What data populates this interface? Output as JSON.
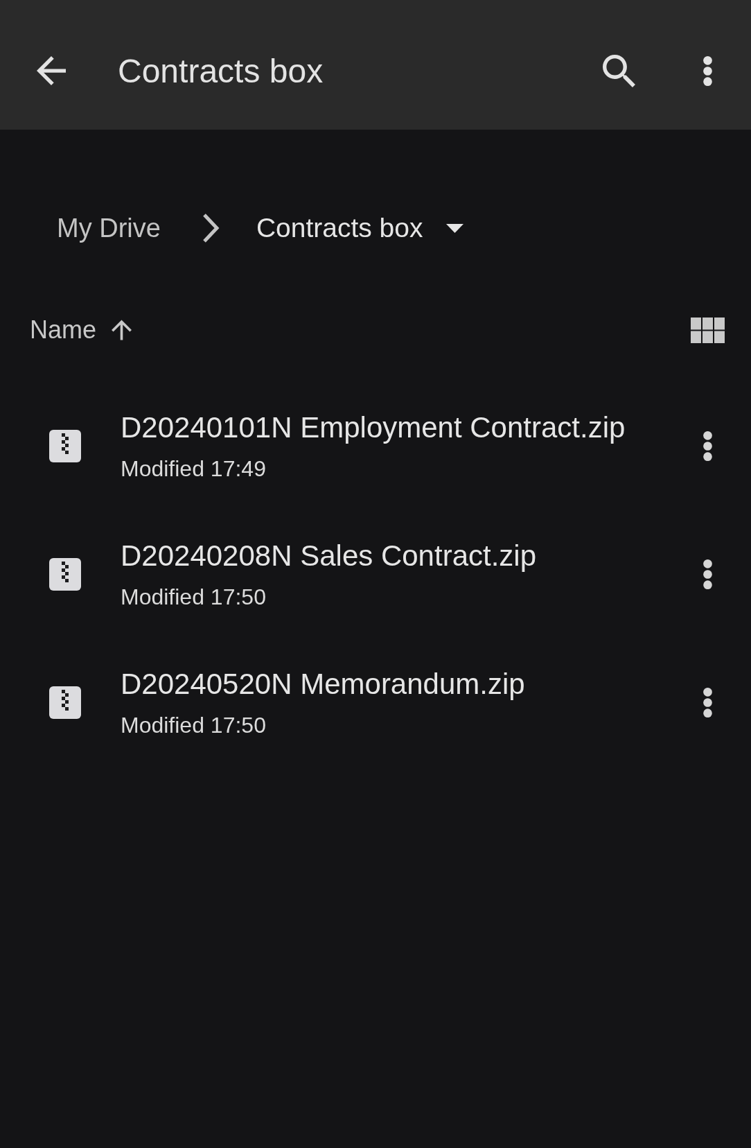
{
  "app_bar": {
    "title": "Contracts box"
  },
  "breadcrumb": {
    "items": [
      {
        "label": "My Drive",
        "current": false
      },
      {
        "label": "Contracts box",
        "current": true
      }
    ]
  },
  "sort": {
    "label": "Name",
    "ascending": true
  },
  "files": [
    {
      "name": "D20240101N Employment Contract.zip",
      "modified": "Modified 17:49"
    },
    {
      "name": "D20240208N Sales Contract.zip",
      "modified": "Modified 17:50"
    },
    {
      "name": "D20240520N Memorandum.zip",
      "modified": "Modified 17:50"
    }
  ]
}
